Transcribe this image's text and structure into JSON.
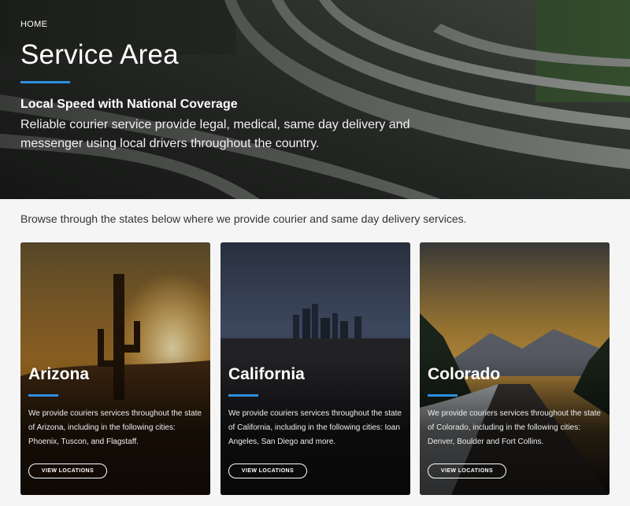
{
  "hero": {
    "breadcrumb": "HOME",
    "title": "Service Area",
    "subtitle": "Local Speed with National Coverage",
    "text": "Reliable courier service provide legal, medical, same day delivery and messenger using local drivers throughout the country.",
    "image": "highway-interchange-photo"
  },
  "intro": {
    "text": "Browse through the states below where we provide courier and same day delivery services."
  },
  "accent_color": "#2d8fe0",
  "cards": [
    {
      "title": "Arizona",
      "text": "We provide couriers services throughout the state of Arizona, including in the following cities: Phoenix, Tuscon, and Flagstaff.",
      "button": "VIEW LOCATIONS",
      "image": "desert-cactus-sunset-photo"
    },
    {
      "title": "California",
      "text": "We provide couriers services throughout the state of California, including in the following cities: Ioan Angeles, San Diego and more.",
      "button": "VIEW LOCATIONS",
      "image": "city-skyline-photo"
    },
    {
      "title": "Colorado",
      "text": "We provide couriers services throughout the state of Colorado, including in the following cities: Denver, Boulder and Fort Collins.",
      "button": "VIEW LOCATIONS",
      "image": "mountain-road-photo"
    }
  ]
}
